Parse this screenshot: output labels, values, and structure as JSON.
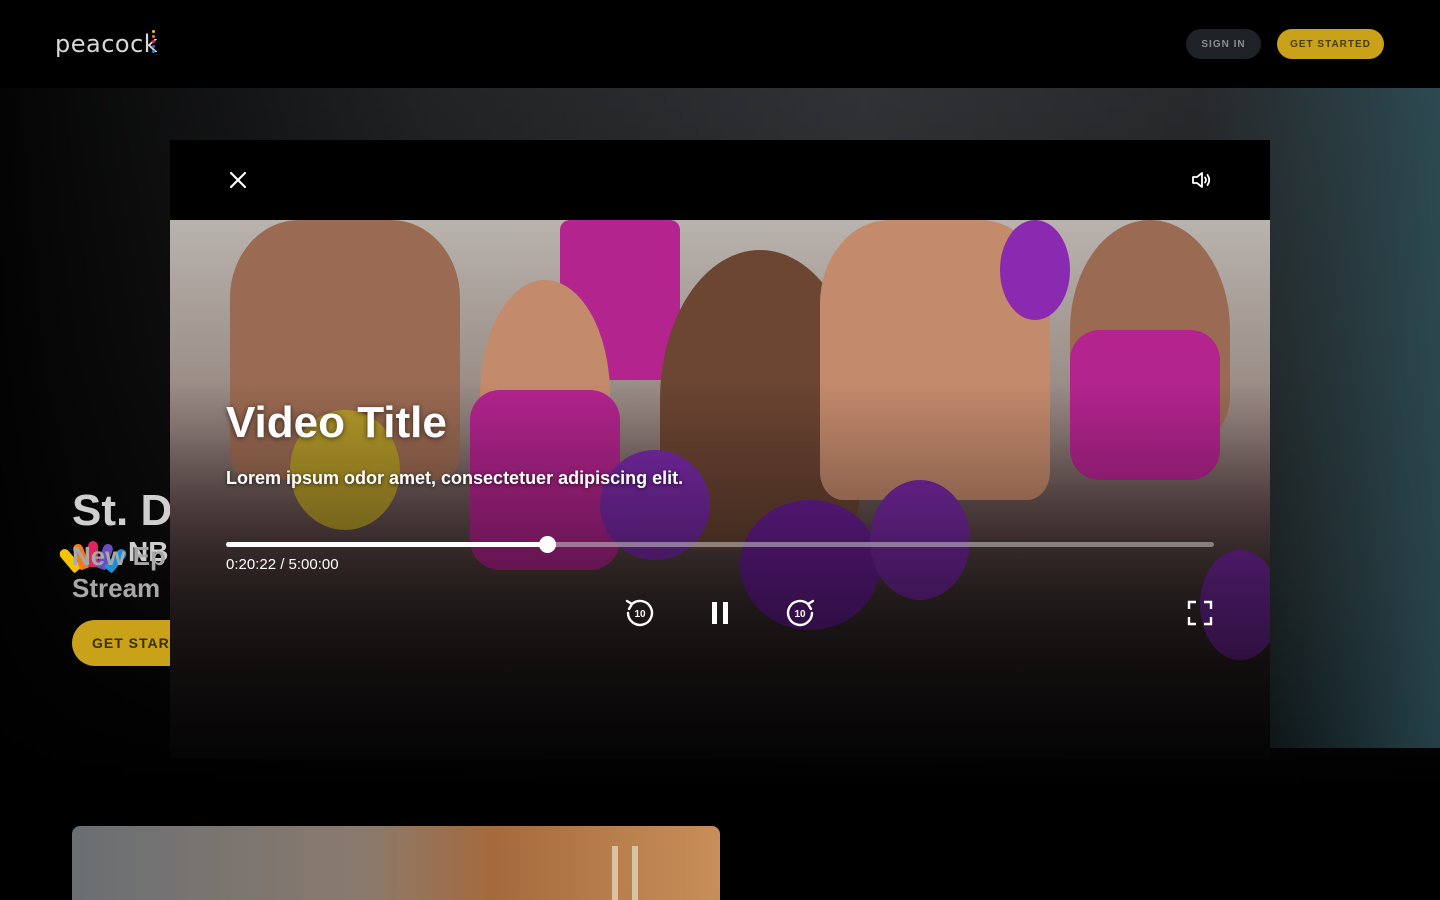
{
  "header": {
    "logo_text": "peacock",
    "sign_in_label": "SIGN IN",
    "get_started_label": "GET STARTED"
  },
  "hero": {
    "network": "NB",
    "title": "St. D",
    "subtitle": "New Ep Stream",
    "cta_label": "GET START"
  },
  "player": {
    "title": "Video Title",
    "description": "Lorem ipsum odor amet, consectetuer adipiscing elit.",
    "time_display": "0:20:22 / 5:00:00",
    "progress": 0.325,
    "rewind_seconds": "10",
    "forward_seconds": "10",
    "icons": {
      "close": "close-icon",
      "volume": "volume-icon",
      "rewind": "rewind-10-icon",
      "pause": "pause-icon",
      "forward": "forward-10-icon",
      "fullscreen": "fullscreen-icon"
    }
  },
  "colors": {
    "accent": "#c9a21a",
    "background": "#000000",
    "progress_fill": "#ffffff"
  }
}
